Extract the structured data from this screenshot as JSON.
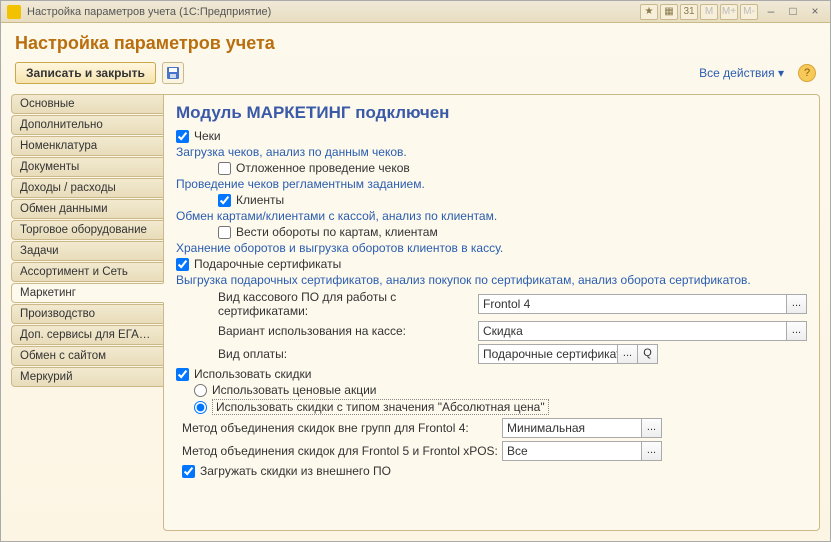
{
  "window": {
    "title": "Настройка параметров учета  (1С:Предприятие)",
    "tb_icons": [
      "★",
      "▦",
      "31",
      "M",
      "M+",
      "M-"
    ],
    "minimize": "–",
    "maximize": "□",
    "close": "×"
  },
  "header": {
    "title": "Настройка параметров учета",
    "save_close": "Записать и закрыть",
    "all_actions": "Все действия ▾",
    "help": "?"
  },
  "tabs": [
    "Основные",
    "Дополнительно",
    "Номенклатура",
    "Документы",
    "Доходы / расходы",
    "Обмен данными",
    "Торговое оборудование",
    "Задачи",
    "Ассортимент и Сеть",
    "Маркетинг",
    "Производство",
    "Доп. сервисы для ЕГАИС",
    "Обмен с сайтом",
    "Меркурий"
  ],
  "content": {
    "heading": "Модуль МАРКЕТИНГ подключен",
    "cheki": "Чеки",
    "cheki_desc": "Загрузка чеков, анализ по данным чеков.",
    "deferred": "Отложенное проведение чеков",
    "deferred_link": "Проведение чеков регламентным заданием.",
    "klienty": "Клиенты",
    "klienty_link": "Обмен картами/клиентами с кассой, анализ по клиентам.",
    "oboroty": "Вести обороты по картам, клиентам",
    "oboroty_link": "Хранение оборотов и выгрузка оборотов клиентов в кассу.",
    "gift": "Подарочные сертификаты",
    "gift_desc": "Выгрузка подарочных сертификатов, анализ покупок по сертификатам, анализ оборота сертификатов.",
    "cert_sw_label": "Вид кассового ПО для работы с сертификатами:",
    "cert_sw_value": "Frontol 4",
    "cert_usage_label": "Вариант использования на кассе:",
    "cert_usage_value": "Скидка",
    "pay_type_label": "Вид оплаты:",
    "pay_type_value": "Подарочные сертификать",
    "use_discounts": "Использовать скидки",
    "radio_price": "Использовать ценовые акции",
    "radio_abs": "Использовать скидки с типом значения \"Абсолютная цена\"",
    "merge1_label": "Метод объединения скидок вне групп для Frontol 4:",
    "merge1_value": "Минимальная",
    "merge2_label": "Метод объединения скидок для Frontol 5 и Frontol xPOS:",
    "merge2_value": "Все",
    "load_ext": "Загружать скидки из внешнего ПО"
  }
}
